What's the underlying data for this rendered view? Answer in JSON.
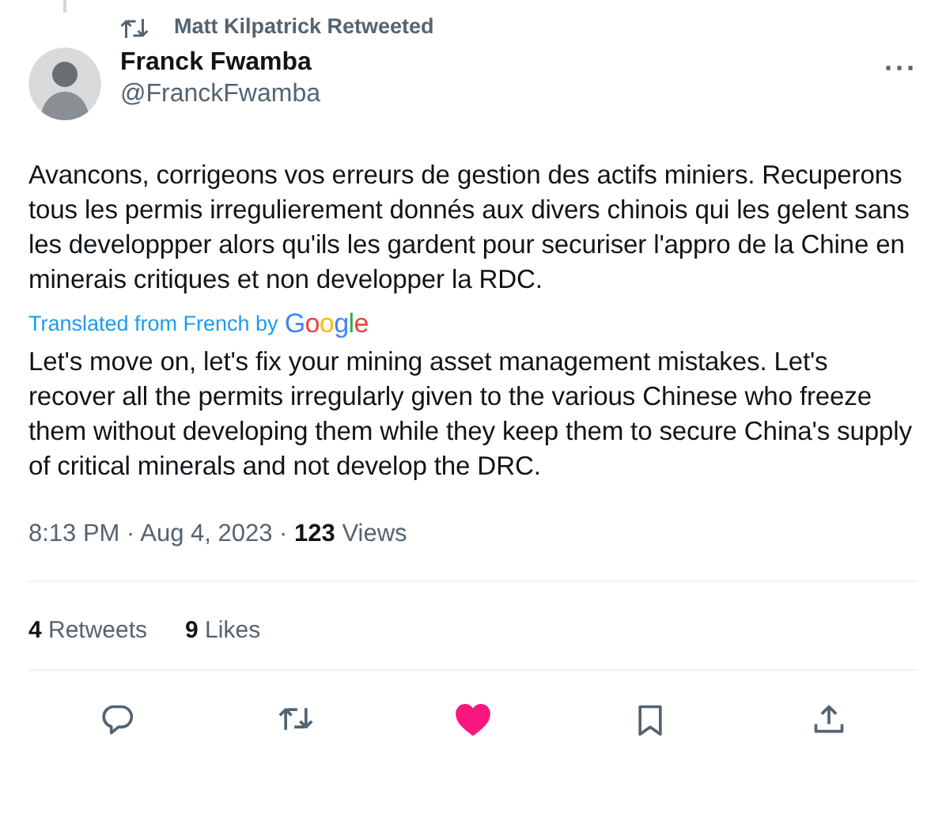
{
  "social_context": {
    "text": "Matt Kilpatrick Retweeted"
  },
  "author": {
    "name": "Franck Fwamba",
    "handle": "@FranckFwamba"
  },
  "more": "···",
  "text": "Avancons, corrigeons vos erreurs de gestion des actifs miniers. Recuperons tous les permis irregulierement donnés aux divers chinois qui les gelent sans les developpper alors qu'ils les gardent pour securiser l'appro de la Chine en minerais critiques et non developper la RDC.",
  "translation_note": {
    "text": "Translated from French by",
    "logo": "Google"
  },
  "translation": "Let's move on, let's fix your mining asset management mistakes. Let's recover all the permits irregularly given to the various Chinese who freeze them without developing them while they keep them to secure China's supply of critical minerals and not develop the DRC.",
  "meta": "8:13 PM · Aug 4, 2023 · **123** Views",
  "stats": [
    "**4** Retweets",
    "**9** Likes"
  ],
  "actions": [
    {
      "kind": "reply"
    },
    {
      "kind": "retweet"
    },
    {
      "kind": "like",
      "selected": true
    },
    {
      "kind": "bookmark"
    },
    {
      "kind": "share"
    }
  ]
}
